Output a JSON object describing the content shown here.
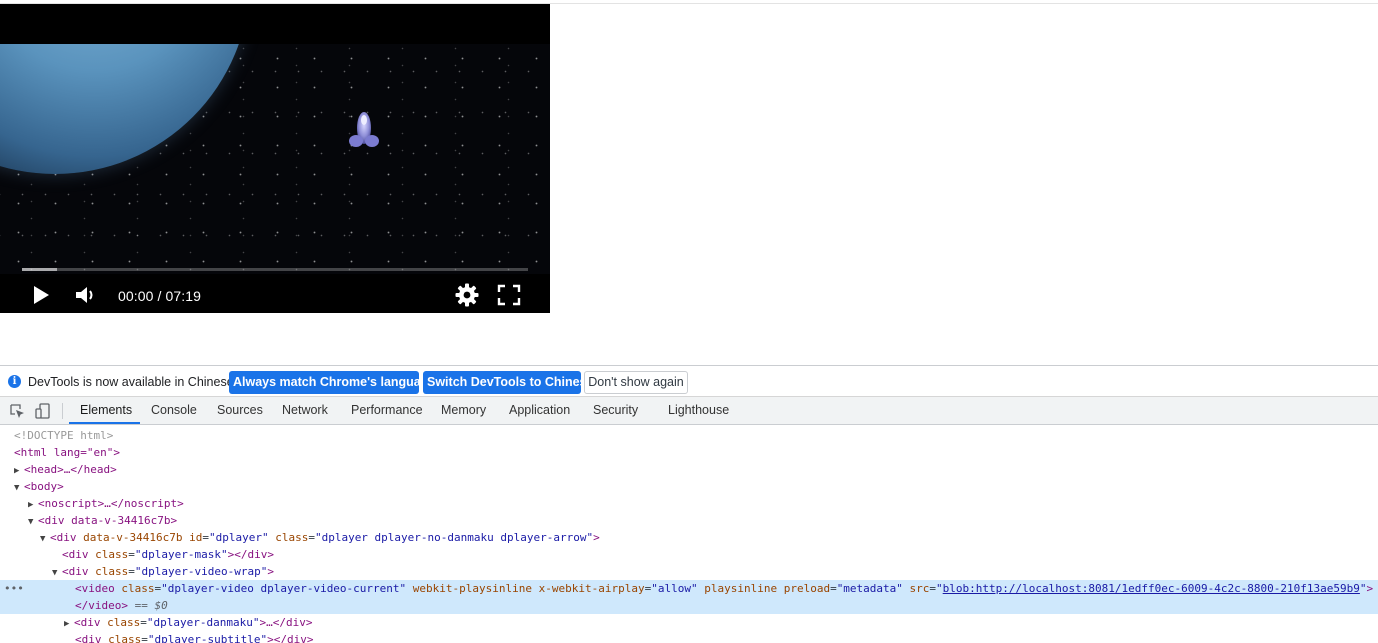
{
  "player": {
    "time": "00:00 / 07:19",
    "progress_played_fraction": 0,
    "buffered_fraction": 0.07,
    "icons": [
      "play-icon",
      "volume-icon",
      "settings-gear-icon",
      "fullscreen-icon"
    ]
  },
  "devtools": {
    "infobar": {
      "message": "DevTools is now available in Chinese!",
      "match_label": "Always match Chrome's language",
      "switch_label": "Switch DevTools to Chinese",
      "dismiss_label": "Don't show again"
    },
    "tabs": [
      "Elements",
      "Console",
      "Sources",
      "Network",
      "Performance",
      "Memory",
      "Application",
      "Security",
      "Lighthouse"
    ],
    "active_tab": "Elements",
    "accent_color": "#1a73e8",
    "dom": {
      "doctype": "<!DOCTYPE html>",
      "html_open": "<html lang=\"en\">",
      "head": "<head>…</head>",
      "body_open": "<body>",
      "noscript": "<noscript>…</noscript>",
      "div_v": "<div data-v-34416c7b>",
      "div_dplayer_tag": "div",
      "div_dplayer_attr1": "data-v-34416c7b",
      "div_dplayer_id_attr": "id",
      "div_dplayer_id_val": "\"dplayer\"",
      "div_dplayer_class_attr": "class",
      "div_dplayer_class_val": "\"dplayer dplayer-no-danmaku dplayer-arrow\"",
      "mask_class_val": "\"dplayer-mask\"",
      "wrap_class_val": "\"dplayer-video-wrap\"",
      "video_class_val": "\"dplayer-video dplayer-video-current\"",
      "video_attr_playsinline": "webkit-playsinline",
      "video_attr_airplay": "x-webkit-airplay",
      "video_airplay_val": "\"allow\"",
      "video_attr_playsinline2": "playsinline",
      "video_attr_preload": "preload",
      "video_preload_val": "\"metadata\"",
      "video_attr_src": "src",
      "video_src": "blob:http://localhost:8081/1edff0ec-6009-4c2c-8800-210f13ae59b9",
      "video_close": "</video>",
      "dollar_zero": "== $0",
      "danmaku_class_val": "\"dplayer-danmaku\"",
      "subtitle_class_val": "\"dplayer-subtitle\""
    }
  }
}
